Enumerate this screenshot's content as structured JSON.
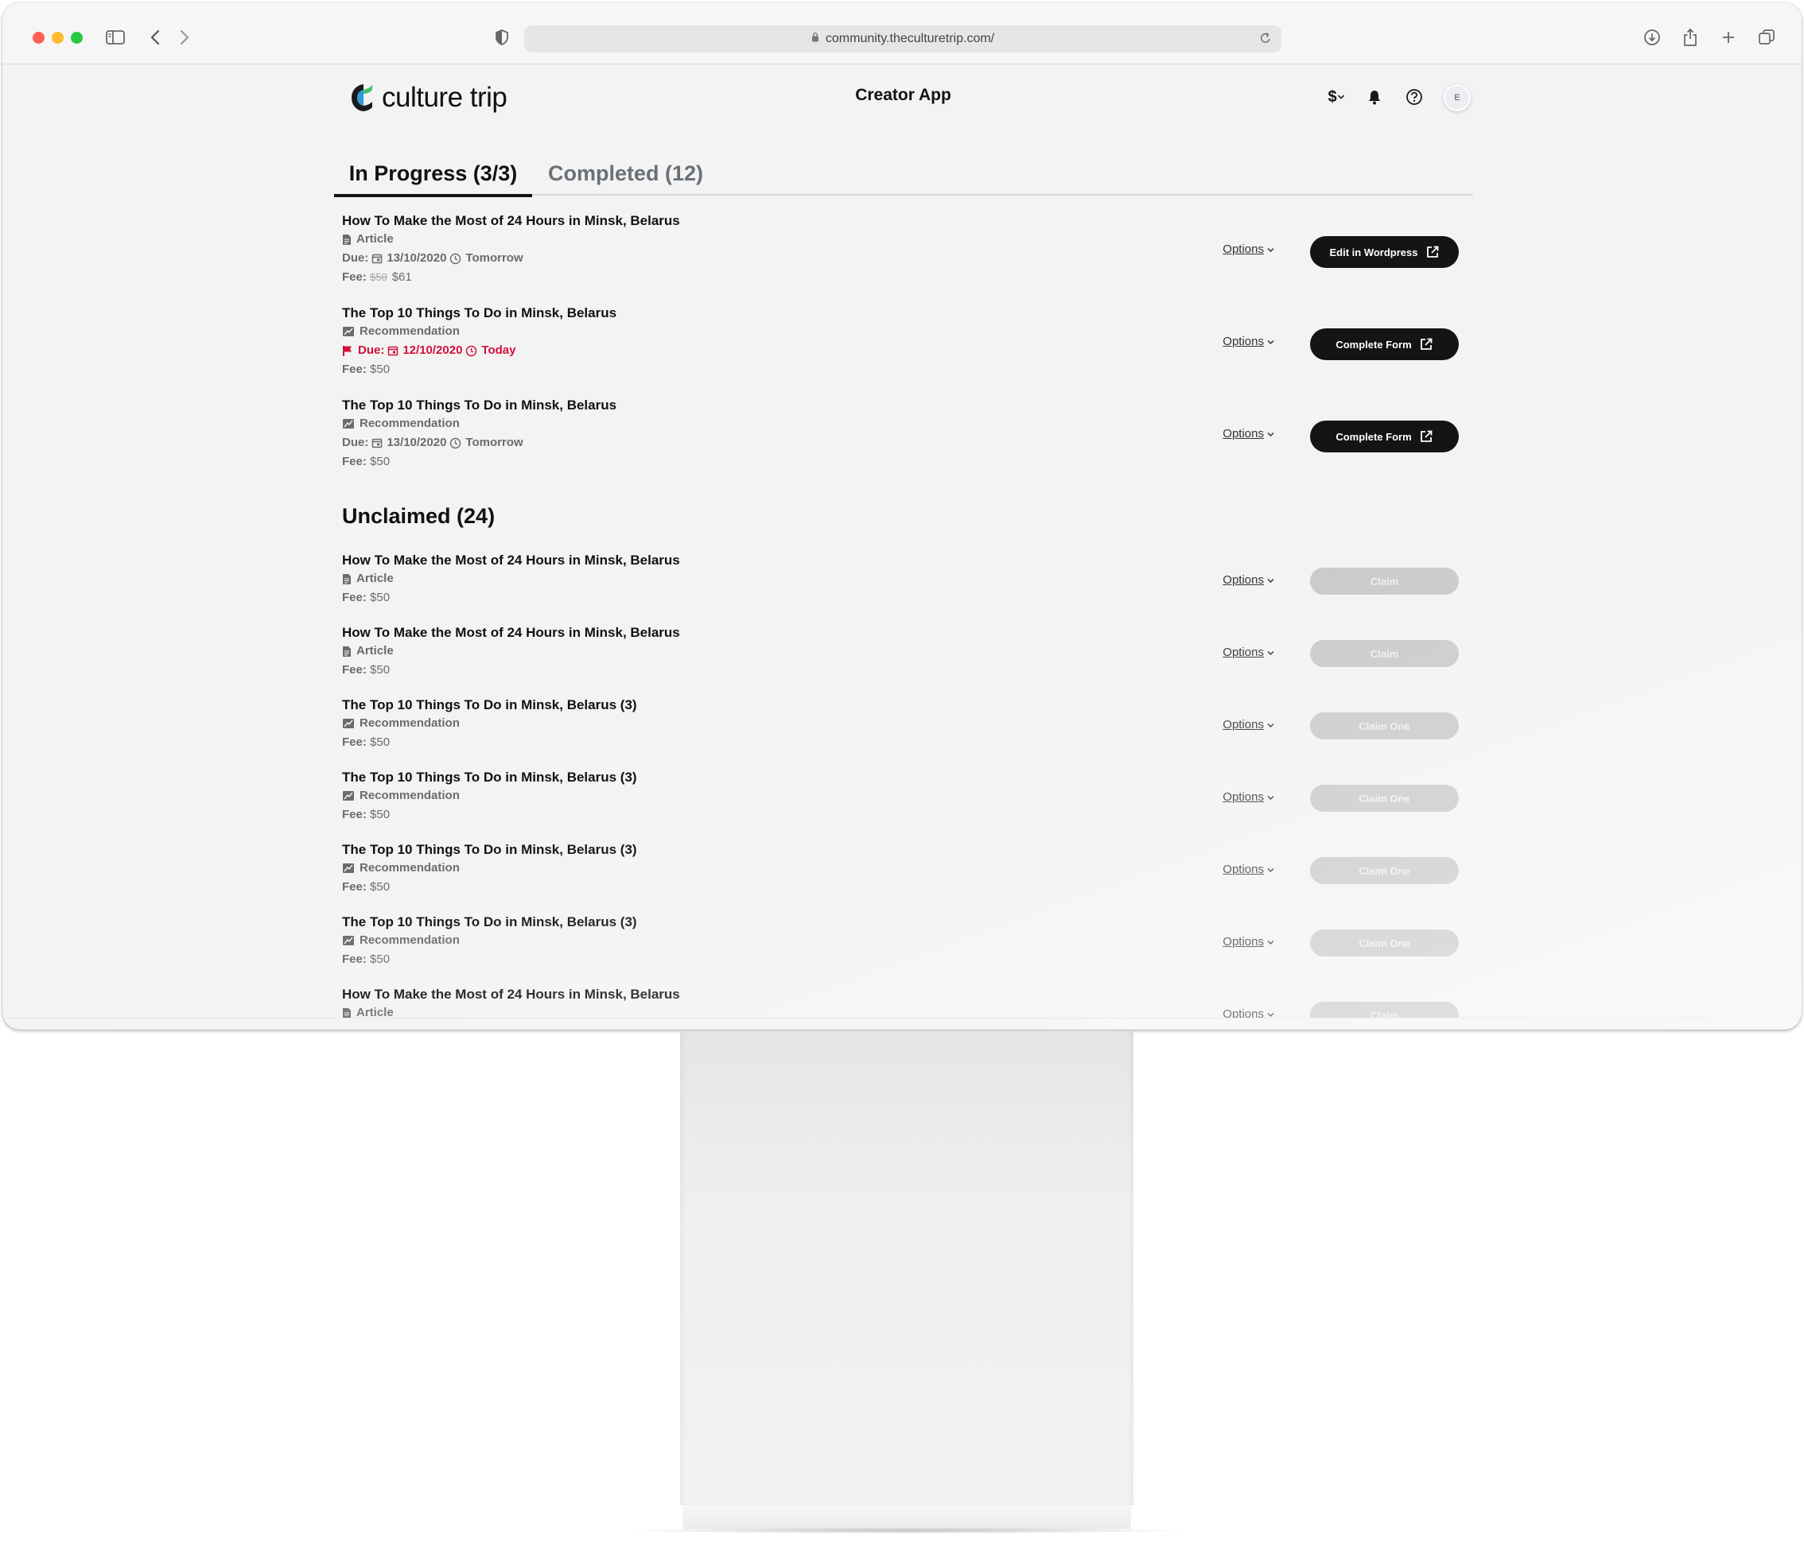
{
  "browser": {
    "url": "community.theculturetrip.com/",
    "traffic_lights": {
      "close": "#ff5f57",
      "minimize": "#febc2e",
      "zoom": "#28c840"
    }
  },
  "header": {
    "logo_text": "culture trip",
    "app_title": "Creator App",
    "currency_symbol": "$",
    "avatar_initial": "E"
  },
  "tabs": [
    {
      "label": "In Progress (3/3)",
      "active": true
    },
    {
      "label": "Completed (12)",
      "active": false
    }
  ],
  "in_progress": [
    {
      "title": "How To Make the Most of 24 Hours in Minsk, Belarus",
      "type": "Article",
      "type_icon": "document-icon",
      "due_label": "Due:",
      "due_date": "13/10/2020",
      "due_relative": "Tomorrow",
      "overdue": false,
      "fee_label": "Fee:",
      "fee_original": "$50",
      "fee": "$61",
      "options_label": "Options",
      "action_label": "Edit in Wordpress"
    },
    {
      "title": "The Top 10 Things To Do in Minsk, Belarus",
      "type": "Recommendation",
      "type_icon": "recommendation-icon",
      "due_label": "Due:",
      "due_date": "12/10/2020",
      "due_relative": "Today",
      "overdue": true,
      "fee_label": "Fee:",
      "fee": "$50",
      "options_label": "Options",
      "action_label": "Complete Form"
    },
    {
      "title": "The Top 10 Things To Do in Minsk, Belarus",
      "type": "Recommendation",
      "type_icon": "recommendation-icon",
      "due_label": "Due:",
      "due_date": "13/10/2020",
      "due_relative": "Tomorrow",
      "overdue": false,
      "fee_label": "Fee:",
      "fee": "$50",
      "options_label": "Options",
      "action_label": "Complete Form"
    }
  ],
  "unclaimed": {
    "title": "Unclaimed (24)",
    "items": [
      {
        "title": "How To Make the Most of 24 Hours in Minsk, Belarus",
        "type": "Article",
        "fee_label": "Fee:",
        "fee": "$50",
        "options_label": "Options",
        "action_label": "Claim"
      },
      {
        "title": "How To Make the Most of 24 Hours in Minsk, Belarus",
        "type": "Article",
        "fee_label": "Fee:",
        "fee": "$50",
        "options_label": "Options",
        "action_label": "Claim"
      },
      {
        "title": "The Top 10 Things To Do in Minsk, Belarus (3)",
        "type": "Recommendation",
        "fee_label": "Fee:",
        "fee": "$50",
        "options_label": "Options",
        "action_label": "Claim One"
      },
      {
        "title": "The Top 10 Things To Do in Minsk, Belarus (3)",
        "type": "Recommendation",
        "fee_label": "Fee:",
        "fee": "$50",
        "options_label": "Options",
        "action_label": "Claim One"
      },
      {
        "title": "The Top 10 Things To Do in Minsk, Belarus (3)",
        "type": "Recommendation",
        "fee_label": "Fee:",
        "fee": "$50",
        "options_label": "Options",
        "action_label": "Claim One"
      },
      {
        "title": "The Top 10 Things To Do in Minsk, Belarus (3)",
        "type": "Recommendation",
        "fee_label": "Fee:",
        "fee": "$50",
        "options_label": "Options",
        "action_label": "Claim One"
      },
      {
        "title": "How To Make the Most of 24 Hours in Minsk, Belarus",
        "type": "Article",
        "options_label": "Options",
        "action_label": "Claim"
      }
    ]
  }
}
